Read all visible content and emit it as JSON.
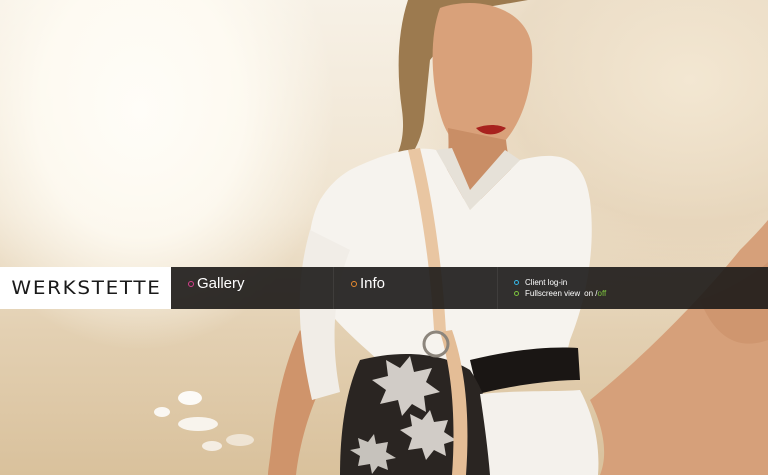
{
  "brand": {
    "logo_text": "WERKSTETTE"
  },
  "nav": {
    "items": [
      {
        "label": "Gallery",
        "dot_color": "#d63f8c"
      },
      {
        "label": "Info",
        "dot_color": "#e98a2e"
      }
    ]
  },
  "utility": {
    "client_login": {
      "label": "Client log-in",
      "dot_color": "#35b6e6"
    },
    "fullscreen": {
      "label": "Fullscreen view",
      "on_label": "on",
      "separator": "/",
      "off_label": "off",
      "dot_color": "#7cc33e",
      "off_color": "#7cc33e"
    }
  },
  "colors": {
    "nav_background": "#1c1a18",
    "logo_background": "#ffffff",
    "nav_text": "#ffffff"
  }
}
